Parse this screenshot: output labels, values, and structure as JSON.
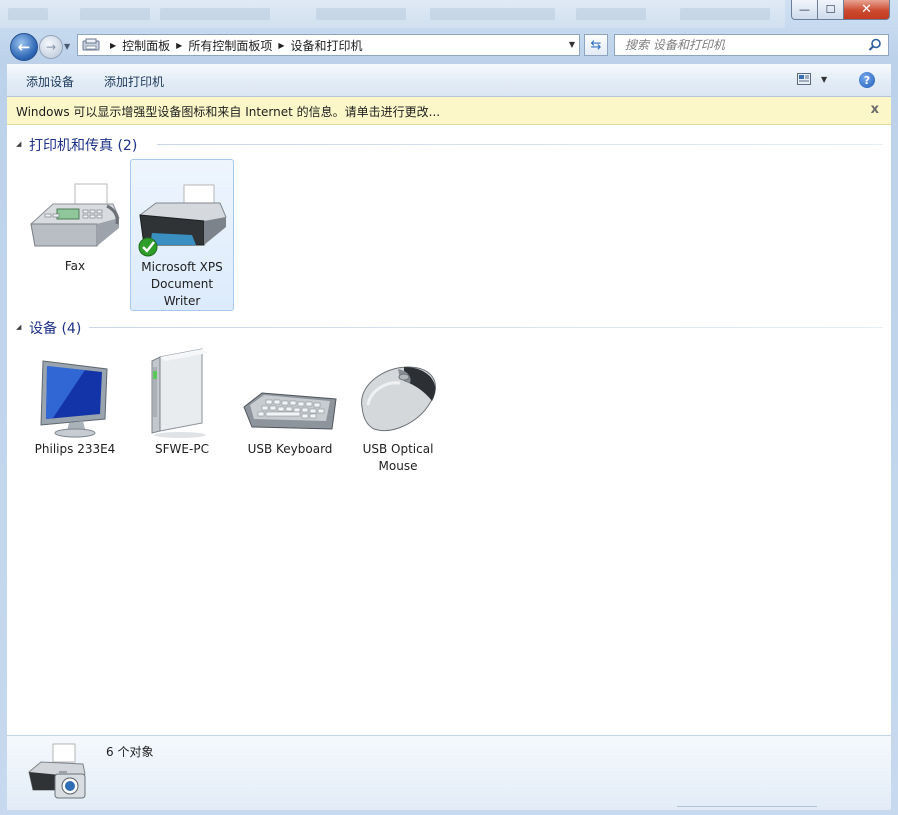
{
  "window": {
    "minimize": "—",
    "maximize": "☐",
    "close": "✕"
  },
  "address": {
    "crumbs": [
      "控制面板",
      "所有控制面板项",
      "设备和打印机"
    ]
  },
  "search": {
    "placeholder": "搜索 设备和打印机"
  },
  "toolbar": {
    "add_device": "添加设备",
    "add_printer": "添加打印机",
    "help": "?"
  },
  "infobar": {
    "text": "Windows 可以显示增强型设备图标和来自 Internet 的信息。请单击进行更改...",
    "close": "x"
  },
  "groups": {
    "printers": {
      "title": "打印机和传真 (2)",
      "items": [
        "Fax",
        "Microsoft XPS Document Writer"
      ]
    },
    "devices": {
      "title": "设备 (4)",
      "items": [
        "Philips 233E4",
        "SFWE-PC",
        "USB Keyboard",
        "USB Optical Mouse"
      ]
    }
  },
  "status": {
    "count": "6 个对象"
  },
  "colors": {
    "group_title": "#1e3287",
    "infobar_bg": "#fcf7c9",
    "selection_border": "#a7c7ed",
    "check_green": "#2e9d2a"
  }
}
